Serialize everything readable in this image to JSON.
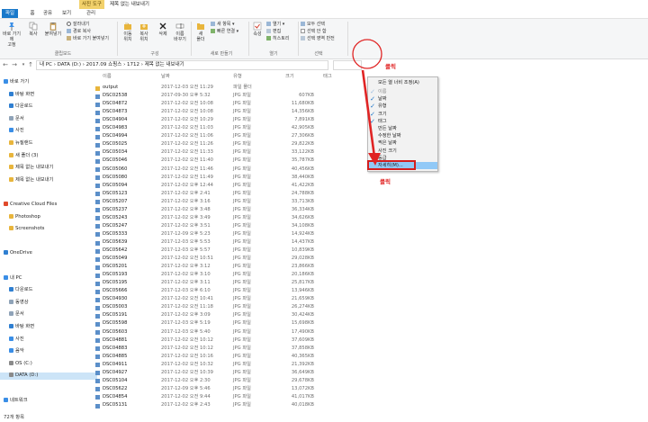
{
  "titlebar": {
    "context_tab": "사진 도구",
    "window_title": "제목 없는 내보내기"
  },
  "ribbon_tabs": [
    "파일",
    "홈",
    "공유",
    "보기",
    "관리"
  ],
  "ribbon": {
    "clipboard": {
      "pin_label": "바로 가기에\n고정",
      "copy_label": "복사",
      "paste_label": "붙여넣기",
      "cut_label": "잘라내기",
      "copy_path_label": "경로 복사",
      "paste_shortcut_label": "바로 가기 붙여넣기",
      "group_label": "클립보드"
    },
    "organize": {
      "move_to_label": "이동\n위치",
      "copy_to_label": "복사\n위치",
      "delete_label": "삭제",
      "rename_label": "이름\n바꾸기",
      "group_label": "구성"
    },
    "new": {
      "new_folder_label": "새\n폴더",
      "new_item_label": "새 항목",
      "easy_access_label": "빠른 연결",
      "group_label": "새로 만들기"
    },
    "open": {
      "properties_label": "속성",
      "open_label": "열기",
      "edit_label": "편집",
      "history_label": "히스토리",
      "group_label": "열기"
    },
    "select": {
      "select_all_label": "모두 선택",
      "select_none_label": "선택 안 함",
      "invert_label": "선택 영역 반전",
      "group_label": "선택"
    }
  },
  "address": {
    "path": "내 PC  ›  DATA (D:)  ›  2017.09 쇼핑스  ›  1712  ›  제목 없는 내보내기"
  },
  "nav": [
    {
      "label": "바로 가기",
      "icon": "star-icon",
      "color": "#3a8ee6",
      "indent": 0
    },
    {
      "label": "바탕 화면",
      "icon": "desktop-icon",
      "color": "#2f7fd1",
      "indent": 1
    },
    {
      "label": "다운로드",
      "icon": "download-icon",
      "color": "#2f7fd1",
      "indent": 1
    },
    {
      "label": "문서",
      "icon": "document-icon",
      "color": "#8fa3b8",
      "indent": 1
    },
    {
      "label": "사진",
      "icon": "picture-icon",
      "color": "#3a8ee6",
      "indent": 1
    },
    {
      "label": "뉴질랜드",
      "icon": "folder-icon",
      "color": "#e8b53c",
      "indent": 1
    },
    {
      "label": "새 폴더 (3)",
      "icon": "folder-icon",
      "color": "#e8b53c",
      "indent": 1
    },
    {
      "label": "제목 없는 내보내기",
      "icon": "folder-icon",
      "color": "#e8b53c",
      "indent": 1
    },
    {
      "label": "제목 없는 내보내기",
      "icon": "folder-icon",
      "color": "#e8b53c",
      "indent": 1
    },
    {
      "label": "",
      "icon": "",
      "color": "",
      "indent": 0
    },
    {
      "label": "Creative Cloud Files",
      "icon": "cloud-icon",
      "color": "#e04a2b",
      "indent": 0
    },
    {
      "label": "Photoshop",
      "icon": "folder-icon",
      "color": "#e8b53c",
      "indent": 1
    },
    {
      "label": "Screenshots",
      "icon": "folder-icon",
      "color": "#e8b53c",
      "indent": 1
    },
    {
      "label": "",
      "icon": "",
      "color": "",
      "indent": 0
    },
    {
      "label": "OneDrive",
      "icon": "onedrive-icon",
      "color": "#2f7fd1",
      "indent": 0
    },
    {
      "label": "",
      "icon": "",
      "color": "",
      "indent": 0
    },
    {
      "label": "내 PC",
      "icon": "pc-icon",
      "color": "#3a8ee6",
      "indent": 0
    },
    {
      "label": "다운로드",
      "icon": "download-icon",
      "color": "#2f7fd1",
      "indent": 1
    },
    {
      "label": "동영상",
      "icon": "video-icon",
      "color": "#8fa3b8",
      "indent": 1
    },
    {
      "label": "문서",
      "icon": "document-icon",
      "color": "#8fa3b8",
      "indent": 1
    },
    {
      "label": "바탕 화면",
      "icon": "desktop-icon",
      "color": "#2f7fd1",
      "indent": 1
    },
    {
      "label": "사진",
      "icon": "picture-icon",
      "color": "#3a8ee6",
      "indent": 1
    },
    {
      "label": "음악",
      "icon": "music-icon",
      "color": "#3a8ee6",
      "indent": 1
    },
    {
      "label": "OS (C:)",
      "icon": "drive-icon",
      "color": "#8a8a8a",
      "indent": 1
    },
    {
      "label": "DATA (D:)",
      "icon": "drive-icon",
      "color": "#8a8a8a",
      "indent": 1,
      "selected": true
    },
    {
      "label": "",
      "icon": "",
      "color": "",
      "indent": 0
    },
    {
      "label": "네트워크",
      "icon": "network-icon",
      "color": "#3a8ee6",
      "indent": 0
    }
  ],
  "list_header": {
    "name": "이름",
    "date": "날짜",
    "type": "유형",
    "size": "크기",
    "tags": "태그"
  },
  "files": [
    {
      "name": "output",
      "date": "2017-12-03 오전 11:29",
      "type": "파일 폴더",
      "size": "",
      "folder": true
    },
    {
      "name": "DSC02538",
      "date": "2017-09-30 오후 5:32",
      "type": "JPG 파일",
      "size": "607KB"
    },
    {
      "name": "DSC04872",
      "date": "2017-12-02 오전 10:08",
      "type": "JPG 파일",
      "size": "11,680KB"
    },
    {
      "name": "DSC04873",
      "date": "2017-12-02 오전 10:08",
      "type": "JPG 파일",
      "size": "14,356KB"
    },
    {
      "name": "DSC04904",
      "date": "2017-12-02 오전 10:29",
      "type": "JPG 파일",
      "size": "7,891KB"
    },
    {
      "name": "DSC04983",
      "date": "2017-12-02 오전 11:03",
      "type": "JPG 파일",
      "size": "42,905KB"
    },
    {
      "name": "DSC04994",
      "date": "2017-12-02 오전 11:06",
      "type": "JPG 파일",
      "size": "27,306KB"
    },
    {
      "name": "DSC05025",
      "date": "2017-12-02 오전 11:26",
      "type": "JPG 파일",
      "size": "29,822KB"
    },
    {
      "name": "DSC05034",
      "date": "2017-12-02 오전 11:33",
      "type": "JPG 파일",
      "size": "33,122KB"
    },
    {
      "name": "DSC05046",
      "date": "2017-12-02 오전 11:40",
      "type": "JPG 파일",
      "size": "35,787KB"
    },
    {
      "name": "DSC05060",
      "date": "2017-12-02 오전 11:46",
      "type": "JPG 파일",
      "size": "40,456KB"
    },
    {
      "name": "DSC05080",
      "date": "2017-12-02 오전 11:49",
      "type": "JPG 파일",
      "size": "38,440KB"
    },
    {
      "name": "DSC05094",
      "date": "2017-12-02 오후 12:44",
      "type": "JPG 파일",
      "size": "41,422KB"
    },
    {
      "name": "DSC05123",
      "date": "2017-12-02 오후 2:41",
      "type": "JPG 파일",
      "size": "24,788KB"
    },
    {
      "name": "DSC05207",
      "date": "2017-12-02 오후 3:16",
      "type": "JPG 파일",
      "size": "33,713KB"
    },
    {
      "name": "DSC05237",
      "date": "2017-12-02 오후 3:48",
      "type": "JPG 파일",
      "size": "36,334KB"
    },
    {
      "name": "DSC05243",
      "date": "2017-12-02 오후 3:49",
      "type": "JPG 파일",
      "size": "34,626KB"
    },
    {
      "name": "DSC05247",
      "date": "2017-12-02 오후 3:51",
      "type": "JPG 파일",
      "size": "34,108KB"
    },
    {
      "name": "DSC05333",
      "date": "2017-12-09 오후 5:23",
      "type": "JPG 파일",
      "size": "14,924KB"
    },
    {
      "name": "DSC05639",
      "date": "2017-12-03 오후 5:53",
      "type": "JPG 파일",
      "size": "14,437KB"
    },
    {
      "name": "DSC05642",
      "date": "2017-12-03 오후 5:57",
      "type": "JPG 파일",
      "size": "10,839KB"
    },
    {
      "name": "DSC05049",
      "date": "2017-12-02 오전 10:51",
      "type": "JPG 파일",
      "size": "29,028KB"
    },
    {
      "name": "DSC05201",
      "date": "2017-12-02 오후 3:12",
      "type": "JPG 파일",
      "size": "23,866KB"
    },
    {
      "name": "DSC05193",
      "date": "2017-12-02 오후 3:10",
      "type": "JPG 파일",
      "size": "20,186KB"
    },
    {
      "name": "DSC05195",
      "date": "2017-12-02 오후 3:11",
      "type": "JPG 파일",
      "size": "25,817KB"
    },
    {
      "name": "DSC05666",
      "date": "2017-12-03 오후 6:10",
      "type": "JPG 파일",
      "size": "13,946KB"
    },
    {
      "name": "DSC04930",
      "date": "2017-12-02 오전 10:41",
      "type": "JPG 파일",
      "size": "21,659KB"
    },
    {
      "name": "DSC05003",
      "date": "2017-12-02 오전 11:18",
      "type": "JPG 파일",
      "size": "26,274KB"
    },
    {
      "name": "DSC05191",
      "date": "2017-12-02 오후 3:09",
      "type": "JPG 파일",
      "size": "30,424KB"
    },
    {
      "name": "DSC05598",
      "date": "2017-12-03 오후 5:19",
      "type": "JPG 파일",
      "size": "15,698KB"
    },
    {
      "name": "DSC05603",
      "date": "2017-12-03 오후 5:40",
      "type": "JPG 파일",
      "size": "17,490KB"
    },
    {
      "name": "DSC04881",
      "date": "2017-12-02 오전 10:12",
      "type": "JPG 파일",
      "size": "37,609KB"
    },
    {
      "name": "DSC04883",
      "date": "2017-12-02 오전 10:12",
      "type": "JPG 파일",
      "size": "37,858KB"
    },
    {
      "name": "DSC04885",
      "date": "2017-12-02 오전 10:16",
      "type": "JPG 파일",
      "size": "40,365KB"
    },
    {
      "name": "DSC04911",
      "date": "2017-12-02 오전 10:32",
      "type": "JPG 파일",
      "size": "21,392KB"
    },
    {
      "name": "DSC04927",
      "date": "2017-12-02 오전 10:39",
      "type": "JPG 파일",
      "size": "36,649KB"
    },
    {
      "name": "DSC05104",
      "date": "2017-12-02 오후 2:30",
      "type": "JPG 파일",
      "size": "29,678KB"
    },
    {
      "name": "DSC05622",
      "date": "2017-12-09 오후 5:46",
      "type": "JPG 파일",
      "size": "13,072KB"
    },
    {
      "name": "DSC04854",
      "date": "2017-12-02 오전 9:44",
      "type": "JPG 파일",
      "size": "41,017KB"
    },
    {
      "name": "DSC05131",
      "date": "2017-12-02 오후 2:43",
      "type": "JPG 파일",
      "size": "40,018KB"
    }
  ],
  "context_menu": {
    "size_all": "모든 열 너비 조정(A)",
    "items": [
      {
        "label": "이름",
        "checked": true,
        "disabled": true
      },
      {
        "label": "날짜",
        "checked": true,
        "disabled": false
      },
      {
        "label": "유형",
        "checked": true,
        "disabled": false
      },
      {
        "label": "크기",
        "checked": true,
        "disabled": false
      },
      {
        "label": "태그",
        "checked": true,
        "disabled": false
      },
      {
        "label": "만든 날짜",
        "checked": false,
        "disabled": false
      },
      {
        "label": "수정한 날짜",
        "checked": false,
        "disabled": false
      },
      {
        "label": "찍은 날짜",
        "checked": false,
        "disabled": false
      },
      {
        "label": "사진 크기",
        "checked": false,
        "disabled": false
      },
      {
        "label": "등급",
        "checked": false,
        "disabled": false
      }
    ],
    "more": "자세히(M)..."
  },
  "annotations": {
    "click_top": "클릭",
    "click_bottom": "클릭",
    "color": "#e02424"
  },
  "status": "72개 항목"
}
